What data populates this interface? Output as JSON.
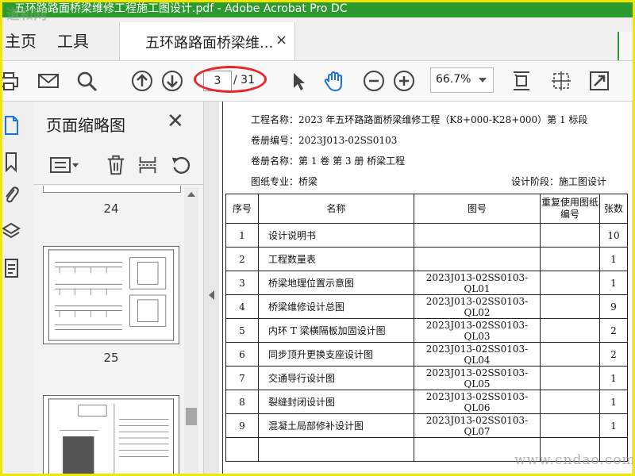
{
  "window": {
    "title": "五环路路面桥梁维修工程施工图设计.pdf - Adobe Acrobat Pro DC"
  },
  "tabs": {
    "home": "主页",
    "tools": "工具",
    "document": "五环路路面桥梁维...",
    "close": "×"
  },
  "toolbar": {
    "current_page": "3",
    "total_pages": "/ 31",
    "zoom": "66.7%"
  },
  "panel": {
    "title": "页面缩略图",
    "close": "✕",
    "thumb_labels": [
      "24",
      "25"
    ]
  },
  "document": {
    "project_name": "工程名称：2023 年五环路路面桥梁维修工程（K8+000-K28+000）第 1 标段",
    "volume_number": "卷册编号：2023J013-02SS0103",
    "volume_name": "卷册名称：第 1 卷  第 3 册  桥梁工程",
    "specialty": "图纸专业：桥梁",
    "design_stage": "设计阶段：施工图设计",
    "headers": {
      "seq": "序号",
      "name": "名称",
      "drawing_no": "图号",
      "reuse": "重复使用图纸编号",
      "sheets": "张数"
    },
    "rows": [
      {
        "seq": "1",
        "name": "设计说明书",
        "drawing_no": "",
        "reuse": "",
        "sheets": "10"
      },
      {
        "seq": "2",
        "name": "工程数量表",
        "drawing_no": "",
        "reuse": "",
        "sheets": "1"
      },
      {
        "seq": "3",
        "name": "桥梁地理位置示意图",
        "drawing_no": "2023J013-02SS0103-QL01",
        "reuse": "",
        "sheets": "1"
      },
      {
        "seq": "4",
        "name": "桥梁维修设计总图",
        "drawing_no": "2023J013-02SS0103-QL02",
        "reuse": "",
        "sheets": "9"
      },
      {
        "seq": "5",
        "name": "内环 T 梁横隔板加固设计图",
        "drawing_no": "2023J013-02SS0103-QL03",
        "reuse": "",
        "sheets": "2"
      },
      {
        "seq": "6",
        "name": "同步顶升更换支座设计图",
        "drawing_no": "2023J013-02SS0103-QL04",
        "reuse": "",
        "sheets": "2"
      },
      {
        "seq": "7",
        "name": "交通导行设计图",
        "drawing_no": "2023J013-02SS0103-QL05",
        "reuse": "",
        "sheets": "1"
      },
      {
        "seq": "8",
        "name": "裂缝封闭设计图",
        "drawing_no": "2023J013-02SS0103-QL06",
        "reuse": "",
        "sheets": "1"
      },
      {
        "seq": "9",
        "name": "混凝土局部修补设计图",
        "drawing_no": "2023J013-02SS0103-QL07",
        "reuse": "",
        "sheets": "1"
      }
    ]
  },
  "watermarks": {
    "top_left": "道和网",
    "bottom_right": "www.cndao.com"
  },
  "colors": {
    "title_bar": "#2d9a2f",
    "icon_blue": "#1a73d9",
    "annotation_red": "#e8262b",
    "frame_yellow": "#f2e600"
  }
}
